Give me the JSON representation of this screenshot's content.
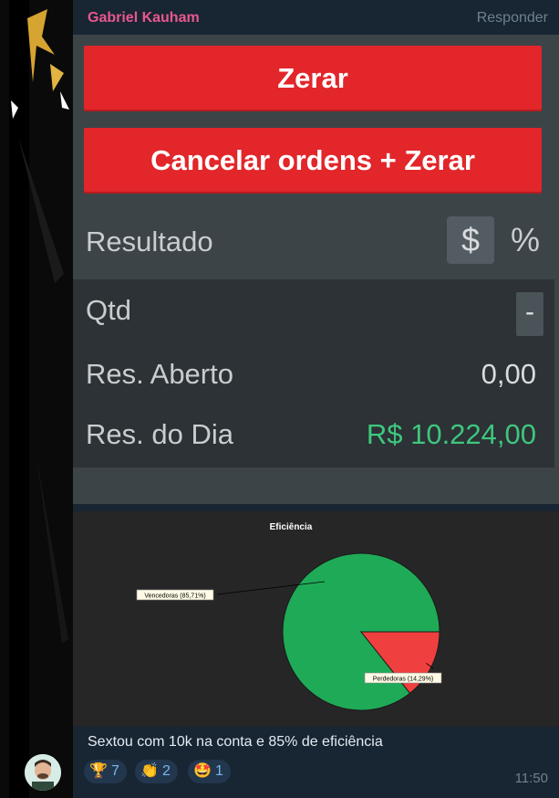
{
  "message": {
    "sender": "Gabriel Kauham",
    "reply_label": "Responder",
    "caption": "Sextou com 10k na conta e 85% de eficiência",
    "time": "11:50"
  },
  "panel": {
    "zerar_label": "Zerar",
    "cancel_label": "Cancelar ordens + Zerar",
    "resultado_label": "Resultado",
    "dollar_toggle": "$",
    "percent_toggle": "%",
    "qtd_label": "Qtd",
    "qtd_value": "-",
    "res_aberto_label": "Res. Aberto",
    "res_aberto_value": "0,00",
    "res_dia_label": "Res. do Dia",
    "res_dia_value": "R$ 10.224,00"
  },
  "chart_data": {
    "type": "pie",
    "title": "Eficiência",
    "slices": [
      {
        "label": "Vencedoras (85,71%)",
        "value": 85.71,
        "color": "#1faa57"
      },
      {
        "label": "Perdedoras (14,29%)",
        "value": 14.29,
        "color": "#f03f3f"
      }
    ]
  },
  "reactions": [
    {
      "emoji": "🏆",
      "count": "7"
    },
    {
      "emoji": "👏",
      "count": "2"
    },
    {
      "emoji": "🤩",
      "count": "1"
    }
  ],
  "colors": {
    "sender": "#e9578e",
    "button_red": "#e2262a",
    "positive_green": "#3ec77e",
    "reaction_text": "#7ab7ec"
  }
}
